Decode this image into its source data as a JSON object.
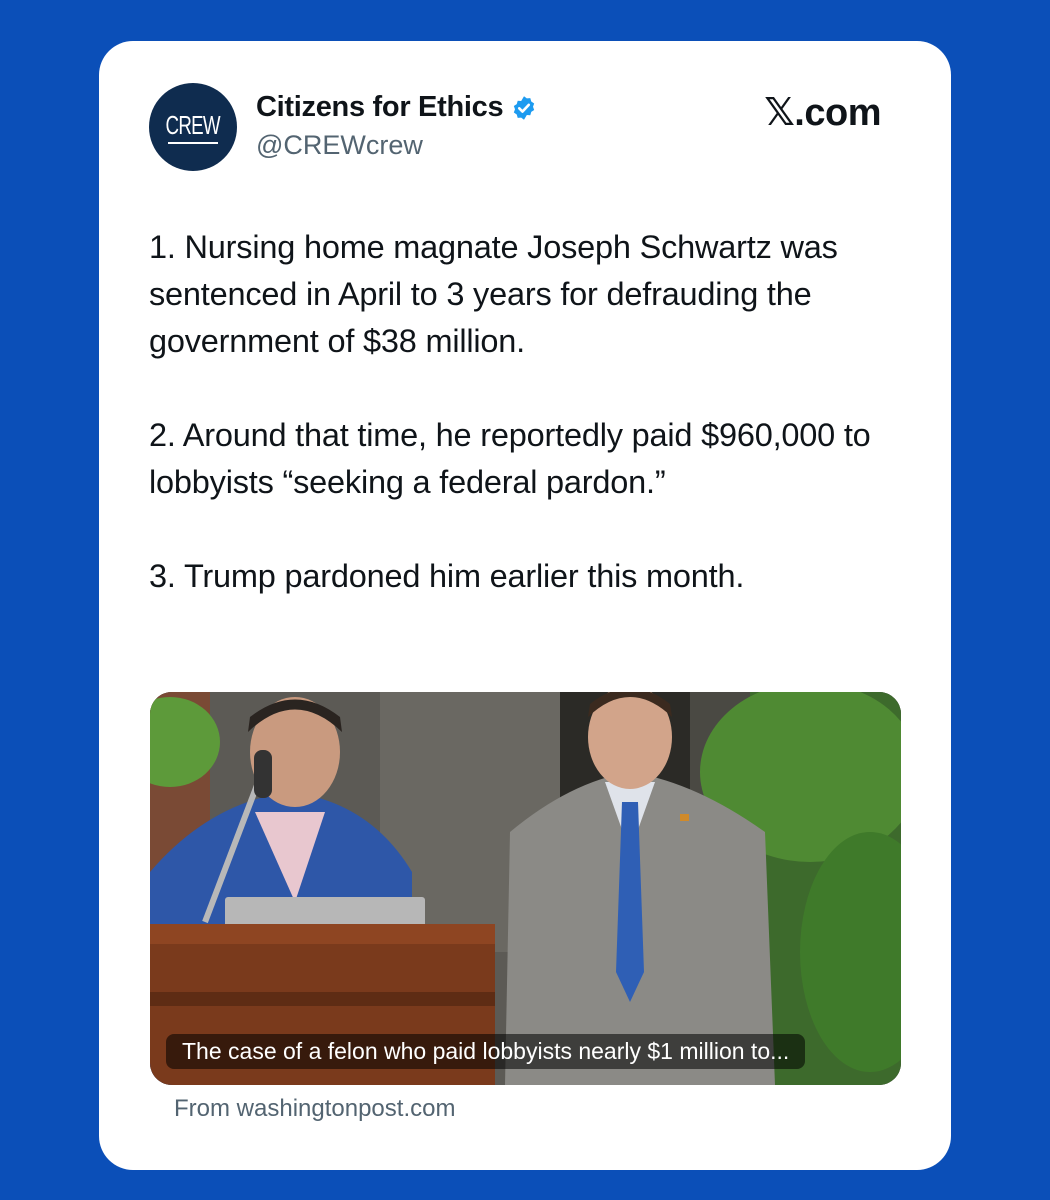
{
  "tweet": {
    "avatar_text": "CREW",
    "display_name": "Citizens for Ethics",
    "handle": "@CREWcrew",
    "brand": "𝕏.com",
    "paragraphs": [
      "1. Nursing home magnate Joseph Schwartz was sentenced in April to 3 years for defrauding the government of $38 million.",
      "2. Around that time, he reportedly paid $960,000 to lobbyists “seeking a federal pardon.”",
      "3. Trump pardoned him earlier this month."
    ]
  },
  "link_card": {
    "caption": "The case of a felon who paid lobbyists nearly $1 million to...",
    "source": "From washingtonpost.com"
  },
  "colors": {
    "page_background": "#0b4fb8",
    "card_background": "#ffffff",
    "avatar_background": "#0f2c4f",
    "verified_badge": "#1d9bf0",
    "primary_text": "#0f1419",
    "secondary_text": "#536471"
  },
  "icons": {
    "verified": "verified-badge-icon"
  }
}
